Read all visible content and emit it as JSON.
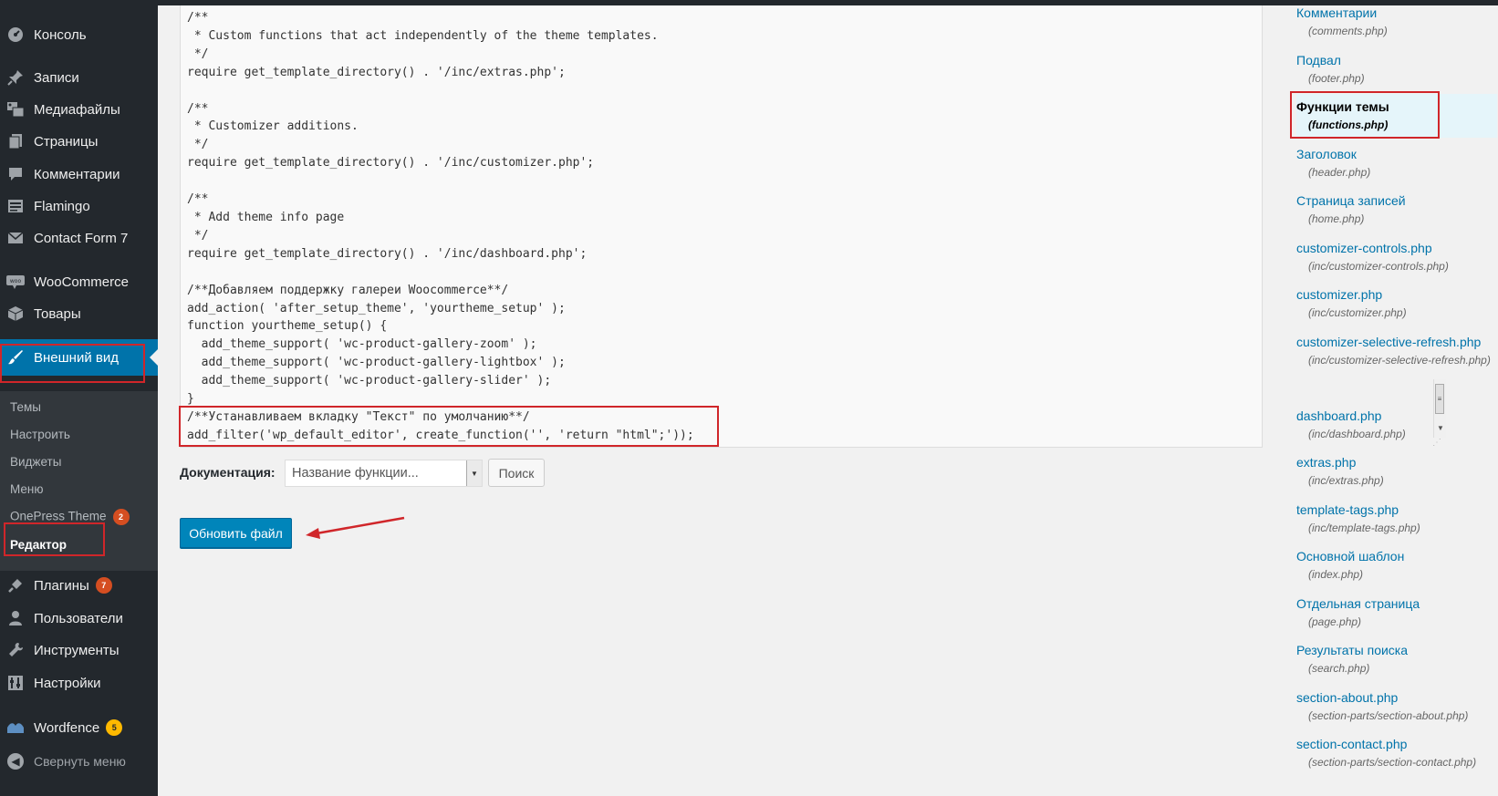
{
  "sidebar": {
    "items": [
      {
        "label": "Консоль",
        "icon": "dashboard-icon"
      },
      {
        "label": "Записи",
        "icon": "pin-icon"
      },
      {
        "label": "Медиафайлы",
        "icon": "media-icon"
      },
      {
        "label": "Страницы",
        "icon": "pages-icon"
      },
      {
        "label": "Комментарии",
        "icon": "comment-icon"
      },
      {
        "label": "Flamingo",
        "icon": "list-icon"
      },
      {
        "label": "Contact Form 7",
        "icon": "mail-icon"
      },
      {
        "label": "WooCommerce",
        "icon": "woo-icon"
      },
      {
        "label": "Товары",
        "icon": "box-icon"
      },
      {
        "label": "Внешний вид",
        "icon": "brush-icon"
      },
      {
        "label": "Плагины",
        "icon": "plugin-icon",
        "badge": "7"
      },
      {
        "label": "Пользователи",
        "icon": "user-icon"
      },
      {
        "label": "Инструменты",
        "icon": "wrench-icon"
      },
      {
        "label": "Настройки",
        "icon": "settings-icon"
      },
      {
        "label": "Wordfence",
        "icon": "wordfence-icon",
        "badge": "5"
      },
      {
        "label": "Свернуть меню",
        "icon": "collapse-icon"
      }
    ],
    "submenu": [
      {
        "label": "Темы"
      },
      {
        "label": "Настроить"
      },
      {
        "label": "Виджеты"
      },
      {
        "label": "Меню"
      },
      {
        "label": "OnePress Theme",
        "badge": "2"
      },
      {
        "label": "Редактор"
      }
    ]
  },
  "editor": {
    "code": "/**\n * Custom functions that act independently of the theme templates.\n */\nrequire get_template_directory() . '/inc/extras.php';\n\n/**\n * Customizer additions.\n */\nrequire get_template_directory() . '/inc/customizer.php';\n\n/**\n * Add theme info page\n */\nrequire get_template_directory() . '/inc/dashboard.php';\n\n/**Добавляем поддержку галереи Woocommerce**/\nadd_action( 'after_setup_theme', 'yourtheme_setup' );\nfunction yourtheme_setup() {\n  add_theme_support( 'wc-product-gallery-zoom' );\n  add_theme_support( 'wc-product-gallery-lightbox' );\n  add_theme_support( 'wc-product-gallery-slider' );\n}\n/**Устанавливаем вкладку \"Текст\" по умолчанию**/\nadd_filter('wp_default_editor', create_function('', 'return \"html\";'));"
  },
  "documentation": {
    "label": "Документация:",
    "select_value": "Название функции...",
    "search_button": "Поиск"
  },
  "update_button": "Обновить файл",
  "files": [
    {
      "name": "Комментарии",
      "path": "(comments.php)"
    },
    {
      "name": "Подвал",
      "path": "(footer.php)"
    },
    {
      "name": "Функции темы",
      "path": "(functions.php)",
      "current": true
    },
    {
      "name": "Заголовок",
      "path": "(header.php)"
    },
    {
      "name": "Страница записей",
      "path": "(home.php)"
    },
    {
      "name": "customizer-controls.php",
      "path": "(inc/customizer-controls.php)"
    },
    {
      "name": "customizer.php",
      "path": "(inc/customizer.php)"
    },
    {
      "name": "customizer-selective-refresh.php",
      "path": "(inc/customizer-selective-refresh.php)"
    },
    {
      "name": "dashboard.php",
      "path": "(inc/dashboard.php)"
    },
    {
      "name": "extras.php",
      "path": "(inc/extras.php)"
    },
    {
      "name": "template-tags.php",
      "path": "(inc/template-tags.php)"
    },
    {
      "name": "Основной шаблон",
      "path": "(index.php)"
    },
    {
      "name": "Отдельная страница",
      "path": "(page.php)"
    },
    {
      "name": "Результаты поиска",
      "path": "(search.php)"
    },
    {
      "name": "section-about.php",
      "path": "(section-parts/section-about.php)"
    },
    {
      "name": "section-contact.php",
      "path": "(section-parts/section-contact.php)"
    }
  ],
  "colors": {
    "sidebar_bg": "#23282d",
    "active_menu": "#0073aa",
    "primary_button": "#0085ba",
    "annotation_red": "#d0262a",
    "link": "#0073aa"
  }
}
